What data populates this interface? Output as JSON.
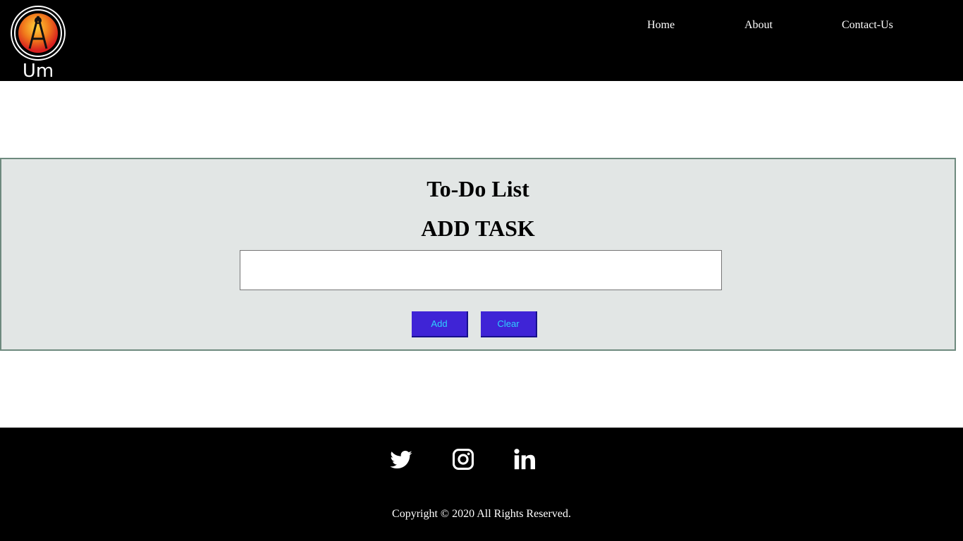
{
  "header": {
    "logo_text": "Um",
    "nav": [
      {
        "label": "Home"
      },
      {
        "label": "About"
      },
      {
        "label": "Contact-Us"
      }
    ]
  },
  "todo": {
    "title": "To-Do List",
    "subtitle": "ADD TASK",
    "input_value": "",
    "add_label": "Add",
    "clear_label": "Clear"
  },
  "footer": {
    "social_icons": [
      "twitter-icon",
      "instagram-icon",
      "linkedin-icon"
    ],
    "copyright": "Copyright © 2020 All Rights Reserved."
  },
  "colors": {
    "header_bg": "#000000",
    "panel_bg": "#e2e6e5",
    "panel_border": "#6e8a7e",
    "button_bg": "#3f24d6",
    "button_text": "#2fd0ff"
  }
}
